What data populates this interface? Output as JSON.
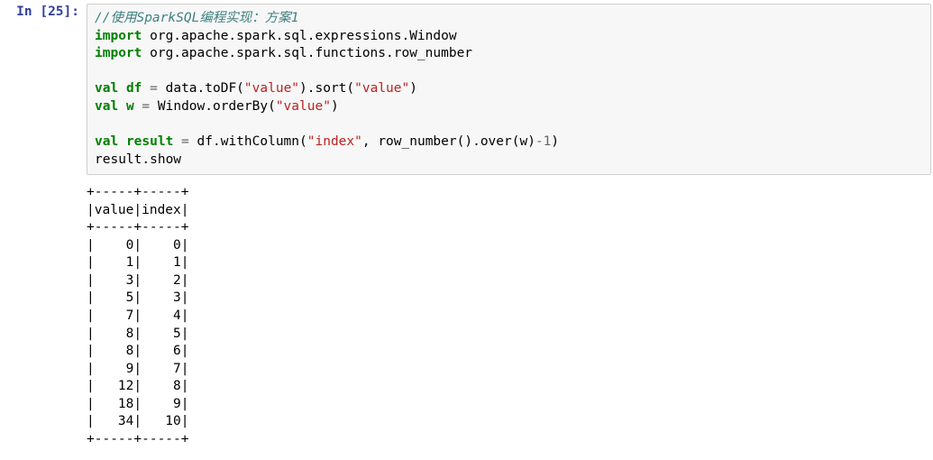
{
  "prompt": {
    "in_label": "In [25]:"
  },
  "code": {
    "comment": "//使用SparkSQL编程实现：方案1",
    "kw_import": "import",
    "imp1": " org.apache.spark.sql.expressions.Window",
    "imp2": " org.apache.spark.sql.functions.row_number",
    "kw_val": "val",
    "df_name": "df",
    "eq": " = ",
    "df_expr_a": "data.toDF(",
    "str_value1": "\"value\"",
    "df_expr_b": ").sort(",
    "str_value2": "\"value\"",
    "df_expr_c": ")",
    "w_name": "w",
    "w_expr_a": "Window.orderBy(",
    "str_value3": "\"value\"",
    "w_expr_b": ")",
    "res_name": "result",
    "res_expr_a": "df.withColumn(",
    "str_index": "\"index\"",
    "comma": ", ",
    "res_expr_b": "row_number().over(w)",
    "minus": "-",
    "one": "1",
    "res_expr_c": ")",
    "show": "result.show"
  },
  "chart_data": {
    "type": "table",
    "columns": [
      "value",
      "index"
    ],
    "rows": [
      [
        0,
        0
      ],
      [
        1,
        1
      ],
      [
        3,
        2
      ],
      [
        5,
        3
      ],
      [
        7,
        4
      ],
      [
        8,
        5
      ],
      [
        8,
        6
      ],
      [
        9,
        7
      ],
      [
        12,
        8
      ],
      [
        18,
        9
      ],
      [
        34,
        10
      ]
    ]
  }
}
